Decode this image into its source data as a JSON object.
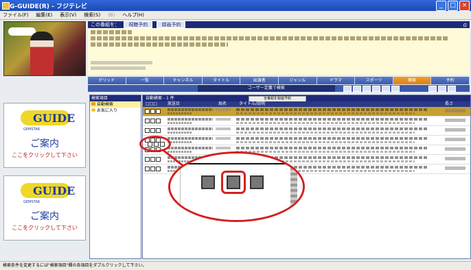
{
  "window": {
    "title": "G-GUIDE(R) - フジテレビ"
  },
  "menu": [
    {
      "label": "ファイル(F)",
      "disabled": false
    },
    {
      "label": "編集(E)",
      "disabled": false
    },
    {
      "label": "表示(V)",
      "disabled": false
    },
    {
      "label": "検索(S)",
      "disabled": false
    },
    {
      "label": "(B)",
      "disabled": true
    },
    {
      "label": "ヘルプ(H)",
      "disabled": false
    }
  ],
  "program": {
    "header_label": "この番組を：",
    "watch_button": "視聴予約",
    "record_button": "録画予約",
    "brand": "G"
  },
  "tabs": [
    "グリッド",
    "一覧",
    "チャンネル",
    "タイトル",
    "出演者",
    "ジャンル",
    "ドラマ",
    "スポーツ",
    "検索",
    "予約"
  ],
  "active_tab": "検索",
  "search": {
    "subtitle": "ユーザー定義で検索",
    "conditions_header": "検索項目",
    "conditions": [
      "自動検索",
      "お気に入り"
    ],
    "results_header": "自動検索 - 1 件",
    "all_record_button": "全番組を録画予約",
    "columns": [
      "放送日",
      "局名",
      "タイトル/説明",
      "長さ"
    ]
  },
  "ads": [
    {
      "brand": "GUIDE",
      "sub": "GEMSTAR",
      "title": "ご案内",
      "cta": "ここをクリックして下さい"
    },
    {
      "brand": "GUIDE",
      "sub": "GEMSTAR",
      "title": "ご案内",
      "cta": "ここをクリックして下さい"
    }
  ],
  "status_text": "検索条件を変更するには\"検索項目\"欄の各項目をダブルクリックして下さい。"
}
